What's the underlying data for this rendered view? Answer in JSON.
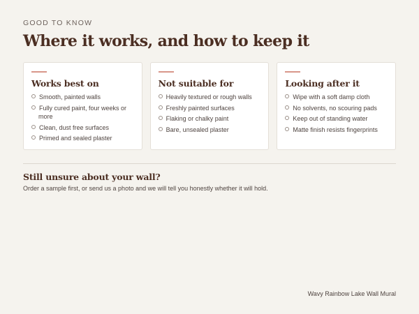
{
  "header": {
    "eyebrow": "GOOD TO KNOW",
    "title": "Where it works, and how to keep it"
  },
  "cards": [
    {
      "title": "Works best on",
      "items": [
        "Smooth, painted walls",
        "Fully cured paint, four weeks or more",
        "Clean, dust free surfaces",
        "Primed and sealed plaster"
      ]
    },
    {
      "title": "Not suitable for",
      "items": [
        "Heavily textured or rough walls",
        "Freshly painted surfaces",
        "Flaking or chalky paint",
        "Bare, unsealed plaster"
      ]
    },
    {
      "title": "Looking after it",
      "items": [
        "Wipe with a soft damp cloth",
        "No solvents, no scouring pads",
        "Keep out of standing water",
        "Matte finish resists fingerprints"
      ]
    }
  ],
  "help": {
    "title": "Still unsure about your wall?",
    "text": "Order a sample first, or send us a photo and we will tell you honestly whether it will hold."
  },
  "footer": {
    "product_name": "Wavy Rainbow Lake Wall Mural"
  },
  "colors": {
    "background": "#f5f3ee",
    "heading": "#4b2e22",
    "accent": "#d8968a",
    "card": "#ffffff"
  }
}
